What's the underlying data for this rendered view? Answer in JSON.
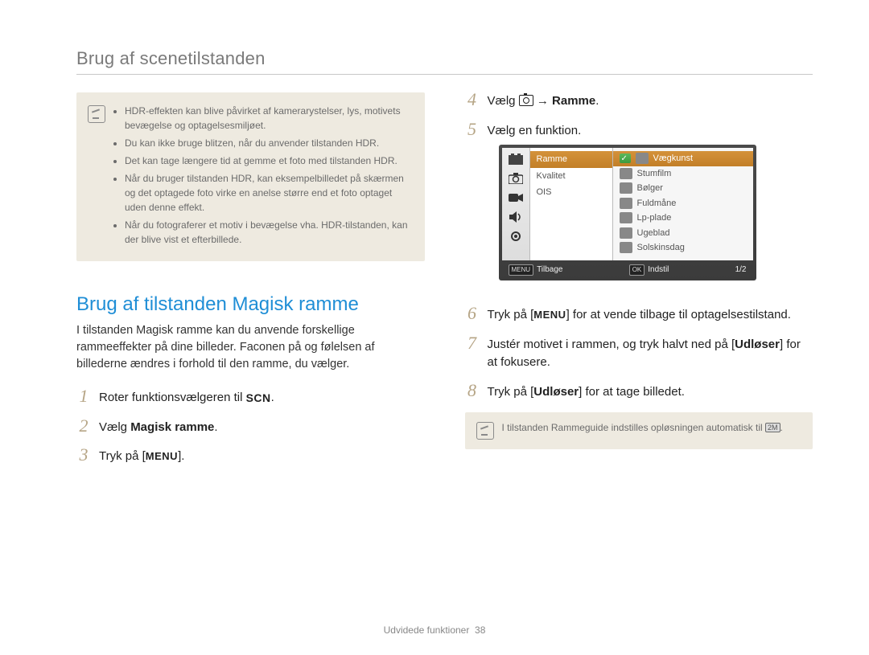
{
  "page_header": "Brug af scenetilstanden",
  "notebox": {
    "items": [
      "HDR-effekten kan blive påvirket af kamerarystelser, lys, motivets bevægelse og optagelsesmiljøet.",
      "Du kan ikke bruge blitzen, når du anvender tilstanden HDR.",
      "Det kan tage længere tid at gemme et foto med tilstanden HDR.",
      "Når du bruger tilstanden HDR, kan eksempelbilledet på skærmen og det optagede foto virke en anelse større end et foto optaget uden denne effekt.",
      "Når du fotograferer et motiv i bevægelse vha. HDR-tilstanden, kan der blive vist et efterbillede."
    ]
  },
  "section_title": "Brug af tilstanden Magisk ramme",
  "section_body": "I tilstanden Magisk ramme kan du anvende forskellige rammeeffekter på dine billeder. Faconen på og følelsen af billederne ændres i forhold til den ramme, du vælger.",
  "left_steps": {
    "step1_pre": "Roter funktionsvælgeren til ",
    "step1_icon": "SCN",
    "step2_pre": "Vælg ",
    "step2_bold": "Magisk ramme",
    "step3_pre": "Tryk på [",
    "step3_icon": "MENU",
    "step3_post": "]."
  },
  "right_steps": {
    "step4_pre": "Vælg ",
    "step4_arrow": " → ",
    "step4_bold": "Ramme",
    "step5": "Vælg en funktion.",
    "step6_pre": "Tryk på [",
    "step6_icon": "MENU",
    "step6_post": "] for at vende tilbage til optagelsestilstand.",
    "step7_pre": "Justér motivet i rammen, og tryk halvt ned på [",
    "step7_bold": "Udløser",
    "step7_post": "] for at fokusere.",
    "step8_pre": "Tryk på [",
    "step8_bold": "Udløser",
    "step8_post": "] for at tage billedet."
  },
  "camera_ui": {
    "left_tabs": [
      "scene-icon",
      "camera-icon",
      "video-icon",
      "sound-icon",
      "gear-icon"
    ],
    "mid": {
      "selected": "Ramme",
      "items": [
        "Ramme",
        "Kvalitet",
        "OIS"
      ]
    },
    "right": {
      "selected": "Vægkunst",
      "items": [
        "Vægkunst",
        "Stumfilm",
        "Bølger",
        "Fuldmåne",
        "Lp-plade",
        "Ugeblad",
        "Solskinsdag"
      ]
    },
    "bottom": {
      "back_icon": "MENU",
      "back_label": "Tilbage",
      "ok_icon": "OK",
      "ok_label": "Indstil",
      "page": "1/2"
    }
  },
  "small_note_pre": "I tilstanden Rammeguide indstilles opløsningen automatisk til ",
  "small_note_icon": "2M",
  "footer_label": "Udvidede funktioner",
  "footer_page": "38"
}
